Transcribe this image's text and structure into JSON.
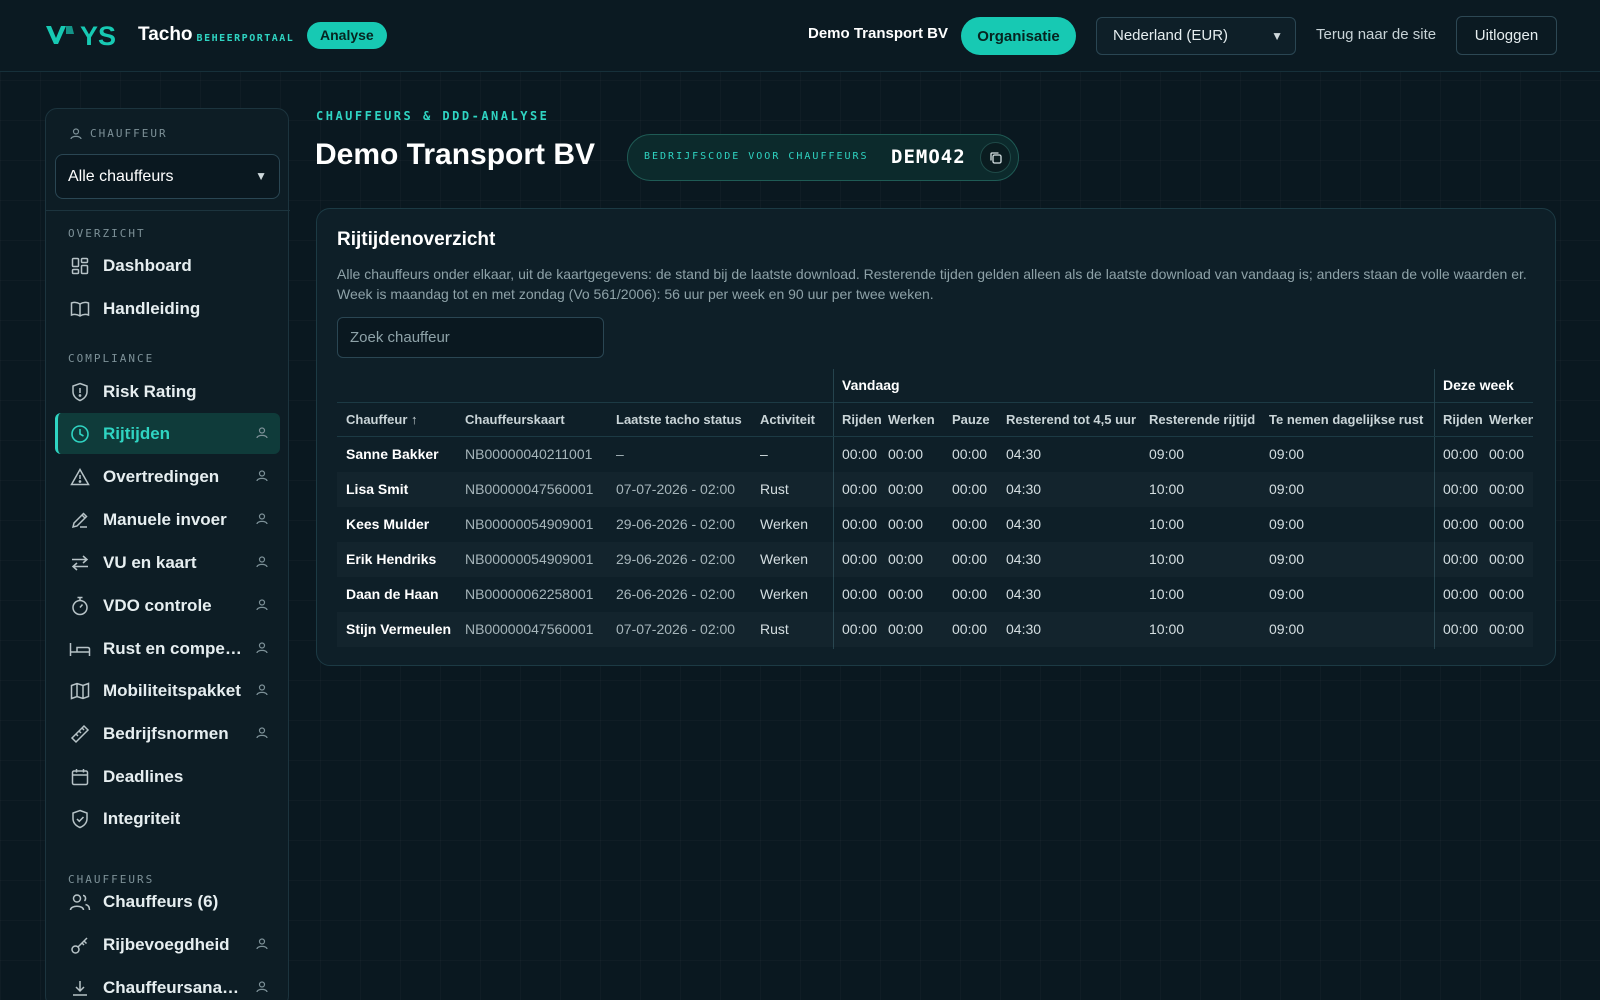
{
  "header": {
    "logo_mark": "YS",
    "logo_title": "Tacho",
    "logo_subtitle": "BEHEERPORTAAL",
    "badge": "Analyse",
    "organization": "Demo Transport BV",
    "org_button": "Organisatie",
    "country_select": "Nederland (EUR)",
    "back_link": "Terug naar de site",
    "logout": "Uitloggen",
    "accent_color": "#17c9b3"
  },
  "sidebar": {
    "chauffeur_label": "CHAUFFEUR",
    "driver_select": "Alle chauffeurs",
    "sections": {
      "overzicht": "OVERZICHT",
      "compliance": "COMPLIANCE",
      "chauffeurs": "CHAUFFEURS"
    },
    "items": [
      {
        "label": "Dashboard",
        "icon": "dashboard-icon"
      },
      {
        "label": "Handleiding",
        "icon": "book-icon"
      },
      {
        "label": "Risk Rating",
        "icon": "shield-icon"
      },
      {
        "label": "Rijtijden",
        "icon": "clock-icon",
        "active": true
      },
      {
        "label": "Overtredingen",
        "icon": "warning-icon"
      },
      {
        "label": "Manuele invoer",
        "icon": "pencil-icon"
      },
      {
        "label": "VU en kaart",
        "icon": "swap-icon"
      },
      {
        "label": "VDO controle",
        "icon": "stopwatch-icon"
      },
      {
        "label": "Rust en compensatie",
        "icon": "bed-icon"
      },
      {
        "label": "Mobiliteitspakket",
        "icon": "map-icon"
      },
      {
        "label": "Bedrijfsnormen",
        "icon": "ruler-icon"
      },
      {
        "label": "Deadlines",
        "icon": "calendar-icon"
      },
      {
        "label": "Integriteit",
        "icon": "shield-check-icon"
      },
      {
        "label": "Chauffeurs (6)",
        "icon": "users-icon"
      },
      {
        "label": "Rijbevoegdheid",
        "icon": "key-icon"
      },
      {
        "label": "Chauffeursanalyse",
        "icon": "download-icon"
      }
    ]
  },
  "main": {
    "eyebrow": "CHAUFFEURS & DDD-ANALYSE",
    "title": "Demo Transport BV",
    "company_code_label": "BEDRIJFSCODE VOOR CHAUFFEURS",
    "company_code": "DEMO42",
    "panel": {
      "title": "Rijtijdenoverzicht",
      "description": "Alle chauffeurs onder elkaar, uit de kaartgegevens: de stand bij de laatste download. Resterende tijden gelden alleen als de laatste download van vandaag is; anders staan de volle waarden er. Week is maandag tot en met zondag (Vo 561/2006): 56 uur per week en 90 uur per twee weken.",
      "search_placeholder": "Zoek chauffeur",
      "groups": {
        "today": "Vandaag",
        "week": "Deze week"
      },
      "columns": [
        "Chauffeur ↑",
        "Chauffeurskaart",
        "Laatste tacho status",
        "Activiteit",
        "Rijden",
        "Werken",
        "Pauze",
        "Resterend tot 4,5 uur",
        "Resterende rijtijd",
        "Te nemen dagelijkse rust",
        "Rijden",
        "Werken"
      ],
      "rows": [
        [
          "Sanne Bakker",
          "NB00000040211001",
          "–",
          "–",
          "00:00",
          "00:00",
          "00:00",
          "04:30",
          "09:00",
          "09:00",
          "00:00",
          "00:00"
        ],
        [
          "Lisa Smit",
          "NB00000047560001",
          "07-07-2026 - 02:00",
          "Rust",
          "00:00",
          "00:00",
          "00:00",
          "04:30",
          "10:00",
          "09:00",
          "00:00",
          "00:00"
        ],
        [
          "Kees Mulder",
          "NB00000054909001",
          "29-06-2026 - 02:00",
          "Werken",
          "00:00",
          "00:00",
          "00:00",
          "04:30",
          "10:00",
          "09:00",
          "00:00",
          "00:00"
        ],
        [
          "Erik Hendriks",
          "NB00000054909001",
          "29-06-2026 - 02:00",
          "Werken",
          "00:00",
          "00:00",
          "00:00",
          "04:30",
          "10:00",
          "09:00",
          "00:00",
          "00:00"
        ],
        [
          "Daan de Haan",
          "NB00000062258001",
          "26-06-2026 - 02:00",
          "Werken",
          "00:00",
          "00:00",
          "00:00",
          "04:30",
          "10:00",
          "09:00",
          "00:00",
          "00:00"
        ],
        [
          "Stijn Vermeulen",
          "NB00000047560001",
          "07-07-2026 - 02:00",
          "Rust",
          "00:00",
          "00:00",
          "00:00",
          "04:30",
          "10:00",
          "09:00",
          "00:00",
          "00:00"
        ]
      ]
    }
  }
}
